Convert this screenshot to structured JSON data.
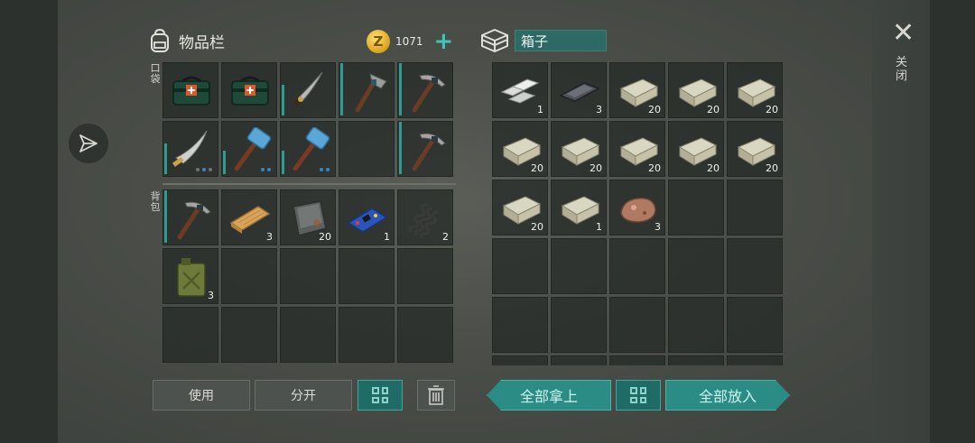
{
  "inventory": {
    "title": "物品栏",
    "coins": "1071",
    "coin_symbol": "Z",
    "plus": "+",
    "pocket_label": "口袋",
    "backpack_label": "背包",
    "pocket_slots": [
      {
        "icon": "medkit-icon",
        "count": ""
      },
      {
        "icon": "medkit-icon",
        "count": ""
      },
      {
        "icon": "machete-icon",
        "count": ""
      },
      {
        "icon": "stone-axe-icon",
        "count": ""
      },
      {
        "icon": "pickaxe-icon",
        "count": ""
      },
      {
        "icon": "cleaver-icon",
        "count": ""
      },
      {
        "icon": "sledgehammer-icon",
        "count": ""
      },
      {
        "icon": "sledgehammer-icon",
        "count": ""
      },
      {
        "icon": "",
        "count": ""
      },
      {
        "icon": "pickaxe-icon",
        "count": ""
      }
    ],
    "backpack_slots": [
      {
        "icon": "pickaxe-icon",
        "count": ""
      },
      {
        "icon": "wood-plank-icon",
        "count": "3"
      },
      {
        "icon": "metal-plate-icon",
        "count": "20"
      },
      {
        "icon": "circuit-board-icon",
        "count": "1"
      },
      {
        "icon": "spring-icon",
        "count": "2"
      },
      {
        "icon": "jerrycan-icon",
        "count": "3"
      }
    ]
  },
  "box": {
    "title": "箱子",
    "slots": [
      {
        "icon": "iron-bars-icon",
        "count": "1"
      },
      {
        "icon": "steel-ingot-icon",
        "count": "3"
      },
      {
        "icon": "stone-block-icon",
        "count": "20"
      },
      {
        "icon": "stone-block-icon",
        "count": "20"
      },
      {
        "icon": "stone-block-icon",
        "count": "20"
      },
      {
        "icon": "stone-block-icon",
        "count": "20"
      },
      {
        "icon": "stone-block-icon",
        "count": "20"
      },
      {
        "icon": "stone-block-icon",
        "count": "20"
      },
      {
        "icon": "stone-block-icon",
        "count": "20"
      },
      {
        "icon": "stone-block-icon",
        "count": "20"
      },
      {
        "icon": "stone-block-icon",
        "count": "20"
      },
      {
        "icon": "stone-block-icon",
        "count": "1"
      },
      {
        "icon": "copper-ore-icon",
        "count": "3"
      }
    ]
  },
  "controls": {
    "use": "使用",
    "split": "分开",
    "take_all": "全部拿上",
    "put_all": "全部放入",
    "close": "关闭",
    "close_symbol": "✕"
  },
  "colors": {
    "accent": "#2a8c84",
    "slot": "#232826",
    "durability": "#2f9c93"
  }
}
